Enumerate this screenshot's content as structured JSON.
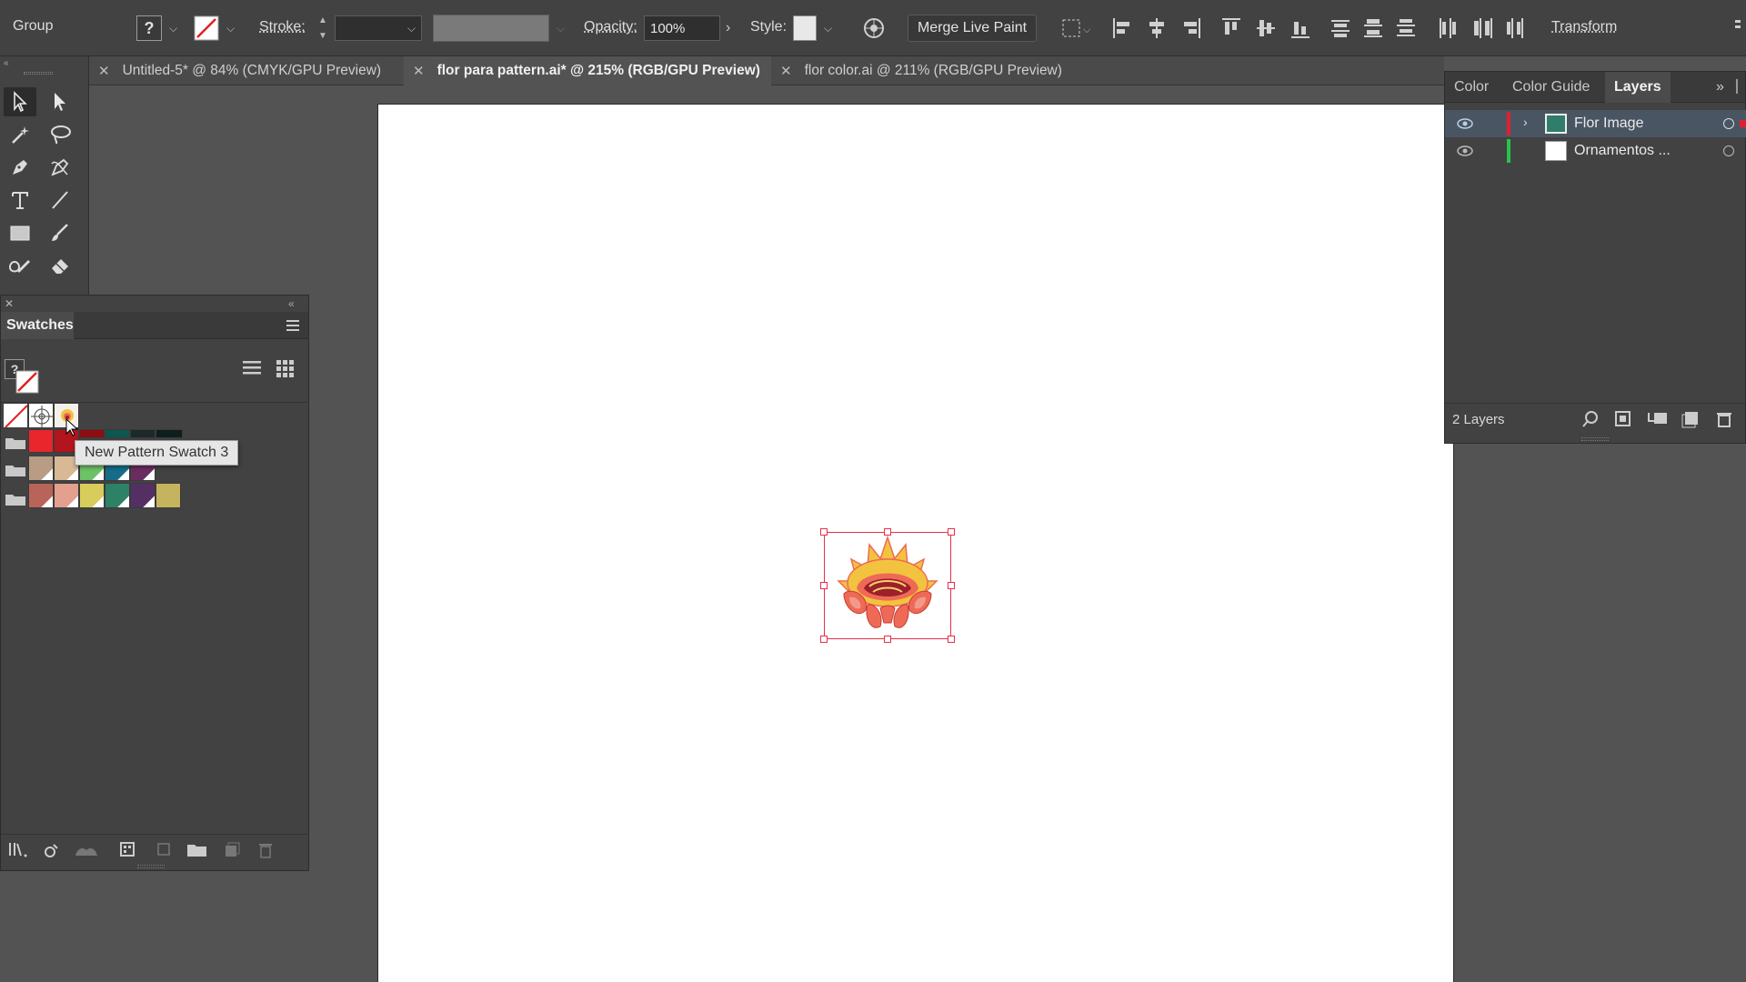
{
  "control_bar": {
    "selection_label": "Group",
    "fill_icon": "question-mark-swatch",
    "stroke_label": "Stroke:",
    "opacity_label": "Opacity:",
    "opacity_value": "100%",
    "style_label": "Style:",
    "merge_button": "Merge Live Paint",
    "transform_label": "Transform"
  },
  "document_tabs": [
    {
      "label": "Untitled-5* @ 84% (CMYK/GPU Preview)",
      "active": false
    },
    {
      "label": "flor para pattern.ai* @ 215% (RGB/GPU Preview)",
      "active": true
    },
    {
      "label": "flor color.ai @ 211% (RGB/GPU Preview)",
      "active": false
    }
  ],
  "tools": [
    "selection-tool",
    "direct-selection-tool",
    "magic-wand-tool",
    "lasso-tool",
    "pen-tool",
    "curvature-tool",
    "type-tool",
    "line-segment-tool",
    "rectangle-tool",
    "paintbrush-tool",
    "shaper-tool",
    "eraser-tool"
  ],
  "swatches_panel": {
    "title": "Swatches",
    "tooltip": "New Pattern Swatch 3",
    "row1": [
      "none",
      "registration",
      "pattern"
    ],
    "group1": [
      "#e8262b",
      "#b3151c",
      "#8e0d12",
      "#0e5650",
      "#1a2a28",
      "#0d1e1c"
    ],
    "group2": [
      "#b89c84",
      "#d8b895",
      "#6dc267",
      "#156d89",
      "#6b2c61"
    ],
    "group3": [
      "#b96458",
      "#e3a08e",
      "#d8cc5a",
      "#2c8166",
      "#542f63",
      "#c6b35e"
    ]
  },
  "layers_panel": {
    "tabs": [
      "Color",
      "Color Guide",
      "Layers"
    ],
    "active_tab": "Layers",
    "layers": [
      {
        "name": "Flor Image",
        "color": "#e02030",
        "selected": true
      },
      {
        "name": "Ornamentos ...",
        "color": "#27c44a",
        "selected": false
      }
    ],
    "footer": "2 Layers"
  },
  "colors": {
    "selection_box": "#e6304a",
    "flower_yellow": "#f2c33f",
    "flower_coral": "#ef6a56",
    "flower_dark": "#9c1f2a"
  }
}
